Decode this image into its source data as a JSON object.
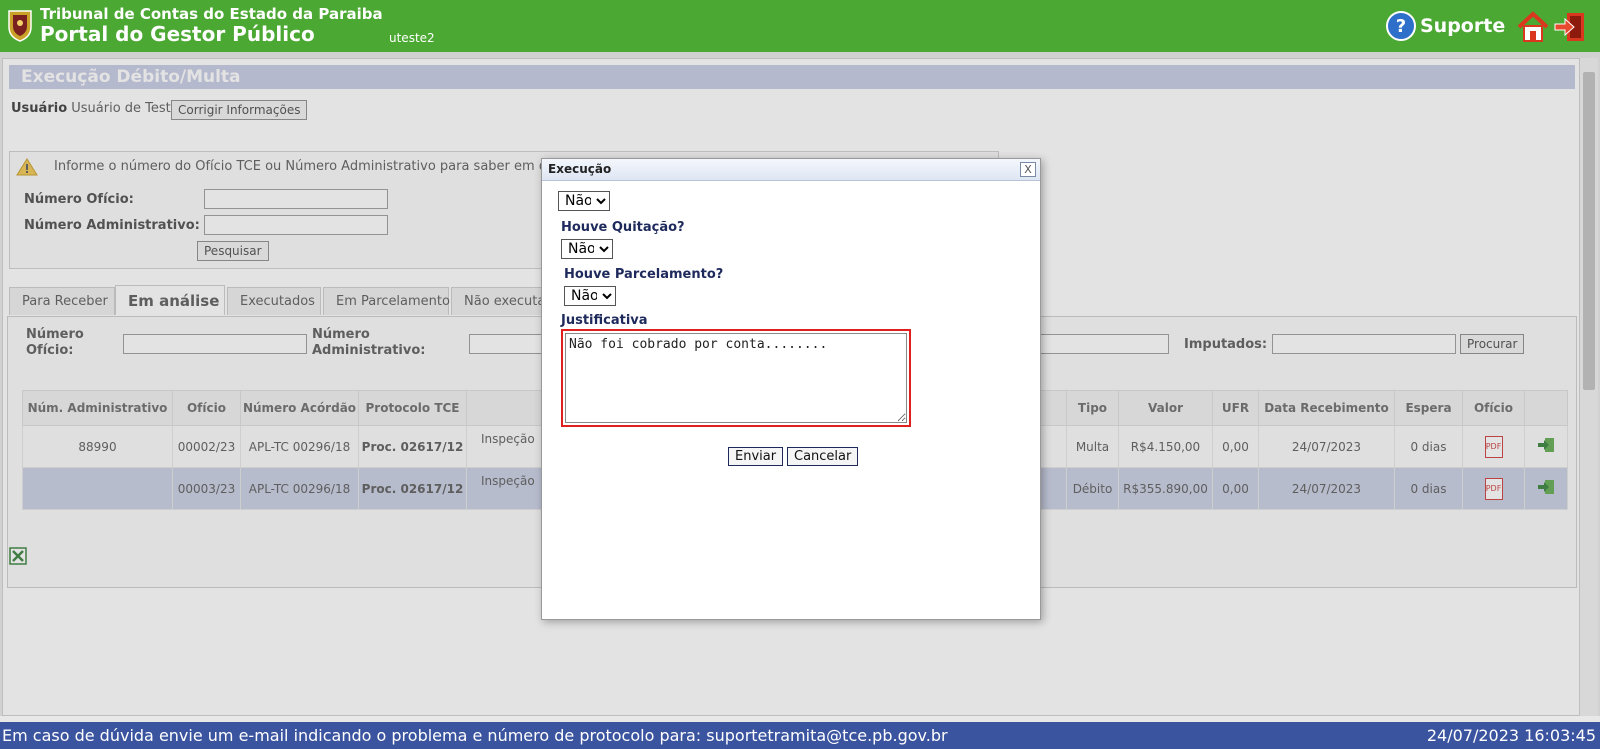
{
  "header": {
    "org_name": "Tribunal de Contas do Estado da Paraiba",
    "portal_name": "Portal do Gestor Público",
    "username": "uteste2",
    "support_label": "Suporte"
  },
  "page": {
    "title": "Execução Débito/Multa",
    "user_label": "Usuário",
    "user_value": "Usuário de Teste",
    "fix_button": "Corrigir Informações",
    "notice": "Informe o número do Ofício TCE ou Número Administrativo para saber em que s",
    "numero_oficio_label": "Número Ofício:",
    "numero_admin_label": "Número Administrativo:",
    "search_button": "Pesquisar"
  },
  "tabs": [
    {
      "label": "Para Receber"
    },
    {
      "label": "Em análise"
    },
    {
      "label": "Executados"
    },
    {
      "label": "Em Parcelamento"
    },
    {
      "label": "Não executa"
    }
  ],
  "filters": {
    "numero_oficio": "Número Ofício:",
    "numero_admin": "Número Administrativo:",
    "imputados": "Imputados:",
    "search_button": "Procurar"
  },
  "table": {
    "headers": [
      "Núm. Administrativo",
      "Ofício",
      "Número Acórdão",
      "Protocolo TCE",
      "",
      "Tipo",
      "Valor",
      "UFR",
      "Data Recebimento",
      "Espera",
      "Ofício",
      ""
    ],
    "rows": [
      {
        "num_admin": "88990",
        "oficio": "00002/23",
        "acordao": "APL-TC 00296/18",
        "protocolo": "Proc. 02617/12",
        "desc": "Inspeção",
        "tipo": "Multa",
        "valor": "R$4.150,00",
        "ufr": "0,00",
        "data": "24/07/2023",
        "espera": "0 dias"
      },
      {
        "num_admin": "",
        "oficio": "00003/23",
        "acordao": "APL-TC 00296/18",
        "protocolo": "Proc. 02617/12",
        "desc": "Inspeção",
        "tipo": "Débito",
        "valor": "R$355.890,00",
        "ufr": "0,00",
        "data": "24/07/2023",
        "espera": "0 dias"
      }
    ]
  },
  "dialog": {
    "title": "Execução",
    "close_label": "X",
    "select1_value": "Não",
    "quitacao_label": "Houve Quitação?",
    "quitacao_value": "Não",
    "parcelamento_label": "Houve Parcelamento?",
    "parcelamento_value": "Não",
    "justificativa_label": "Justificativa",
    "justificativa_value": "Não foi cobrado por conta........",
    "send_button": "Enviar",
    "cancel_button": "Cancelar"
  },
  "footer": {
    "message": "Em caso de dúvida envie um e-mail indicando o problema e número de protocolo para: suportetramita@tce.pb.gov.br",
    "datetime": "24/07/2023 16:03:45"
  },
  "colors": {
    "header_bg": "#4ba832",
    "footer_bg": "#3b54a0",
    "selected_row": "#c7cde3",
    "highlight_border": "#e02020"
  }
}
